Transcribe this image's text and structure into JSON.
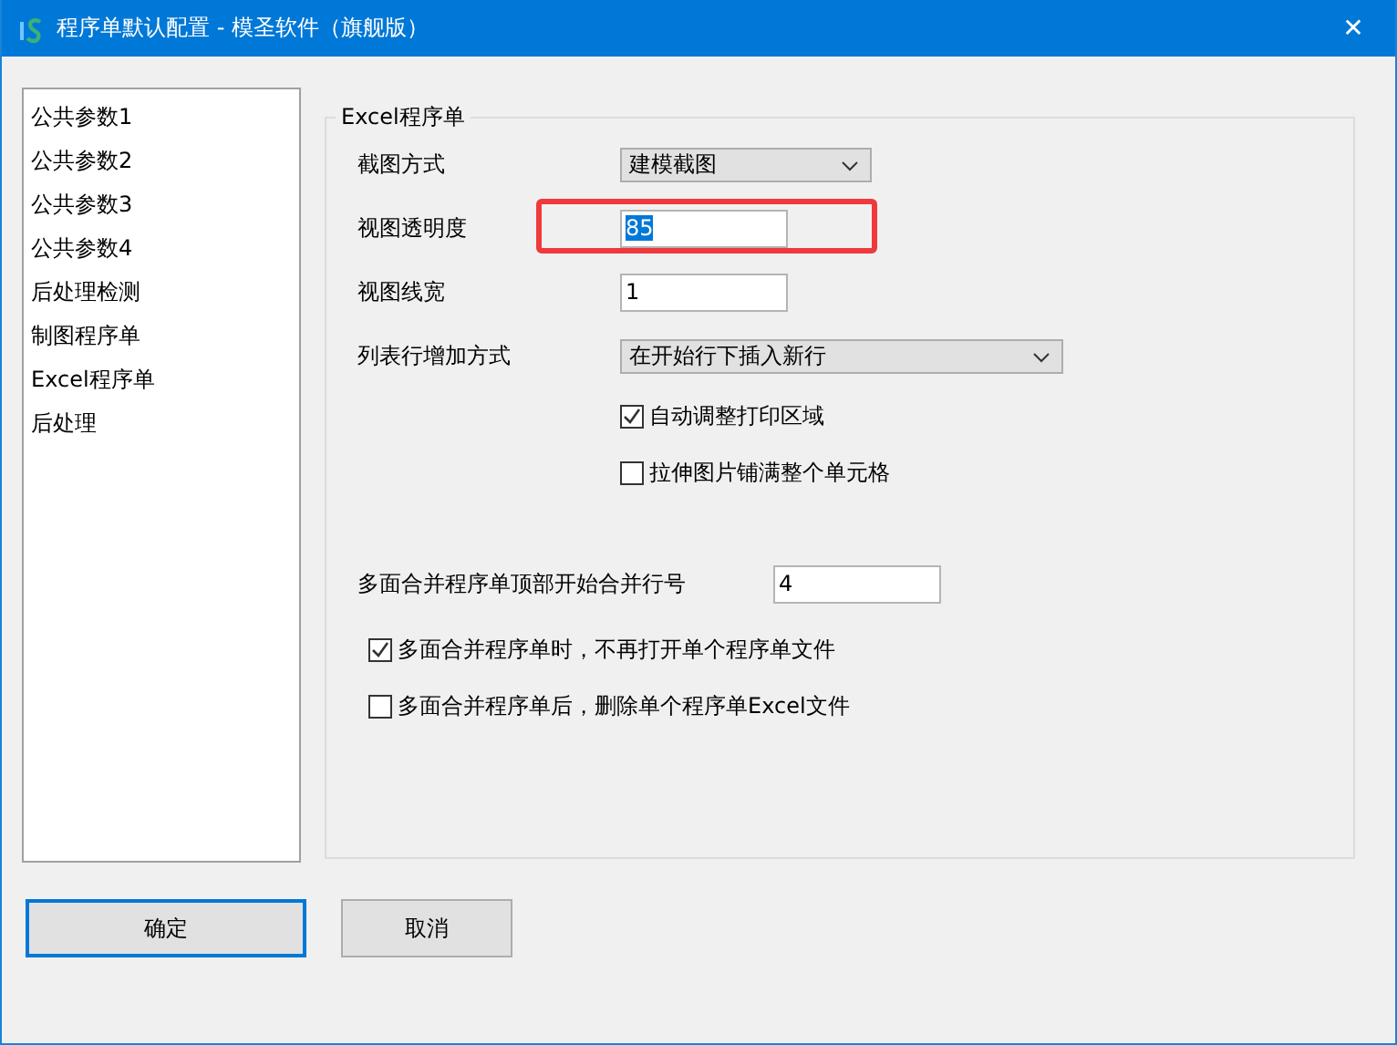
{
  "window": {
    "title": "程序单默认配置 - 模圣软件（旗舰版）",
    "close": "✕"
  },
  "sidebar": {
    "items": [
      {
        "label": "公共参数1"
      },
      {
        "label": "公共参数2"
      },
      {
        "label": "公共参数3"
      },
      {
        "label": "公共参数4"
      },
      {
        "label": "后处理检测"
      },
      {
        "label": "制图程序单"
      },
      {
        "label": "Excel程序单"
      },
      {
        "label": "后处理"
      }
    ]
  },
  "group": {
    "title": "Excel程序单",
    "fields": [
      {
        "kind": "select",
        "label": "截图方式",
        "value": "建模截图"
      },
      {
        "kind": "input",
        "label": "视图透明度",
        "value": "85",
        "text_selected": true,
        "highlighted": true
      },
      {
        "kind": "input",
        "label": "视图线宽",
        "value": "1"
      },
      {
        "kind": "select",
        "label": "列表行增加方式",
        "value": "在开始行下插入新行"
      },
      {
        "kind": "checkbox",
        "label": "自动调整打印区域",
        "checked": true
      },
      {
        "kind": "checkbox",
        "label": "拉伸图片铺满整个单元格",
        "checked": false
      },
      {
        "kind": "number",
        "label": "多面合并程序单顶部开始合并行号",
        "value": "4"
      },
      {
        "kind": "checkbox",
        "label": "多面合并程序单时，不再打开单个程序单文件",
        "checked": true
      },
      {
        "kind": "checkbox",
        "label": "多面合并程序单后，删除单个程序单Excel文件",
        "checked": false
      }
    ]
  },
  "buttons": [
    {
      "label": "确定",
      "default": true
    },
    {
      "label": "取消",
      "default": false
    }
  ]
}
